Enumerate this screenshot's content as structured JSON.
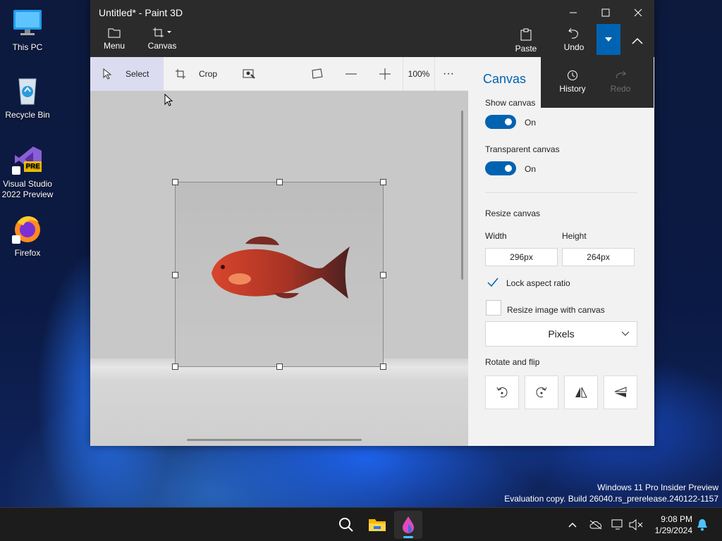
{
  "desktop": {
    "icons": [
      {
        "label": "This PC"
      },
      {
        "label": "Recycle Bin"
      },
      {
        "label": "Visual Studio 2022 Preview",
        "badge": "PRE"
      },
      {
        "label": "Firefox"
      }
    ],
    "watermark": {
      "line1": "Windows 11 Pro Insider Preview",
      "line2": "Evaluation copy. Build 26040.rs_prerelease.240122-1157"
    }
  },
  "window": {
    "title": "Untitled* - Paint 3D",
    "commands": {
      "menu": "Menu",
      "canvas": "Canvas",
      "paste": "Paste",
      "undo": "Undo"
    },
    "history_flyout": {
      "history": "History",
      "redo": "Redo"
    }
  },
  "toolbar": {
    "select": "Select",
    "crop": "Crop",
    "zoom": "100%",
    "more": "···"
  },
  "panel": {
    "title": "Canvas",
    "show_canvas": {
      "label": "Show canvas",
      "state": "On"
    },
    "transparent_canvas": {
      "label": "Transparent canvas",
      "state": "On"
    },
    "resize_canvas": "Resize canvas",
    "width": {
      "label": "Width",
      "value": "296px"
    },
    "height": {
      "label": "Height",
      "value": "264px"
    },
    "lock_aspect": "Lock aspect ratio",
    "resize_image": "Resize image with canvas",
    "units": "Pixels",
    "rotate_flip": "Rotate and flip"
  },
  "taskbar": {
    "time": "9:08 PM",
    "date": "1/29/2024"
  },
  "colors": {
    "accent": "#0063b1",
    "titlebar": "#2b2b2b",
    "fish": "#c0392b"
  }
}
